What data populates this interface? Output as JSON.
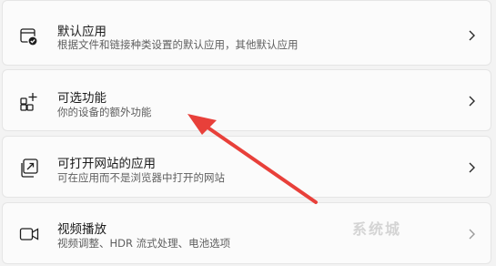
{
  "items": [
    {
      "title": "默认应用",
      "desc": "根据文件和链接种类设置的默认应用，其他默认应用",
      "icon": "default-apps-icon"
    },
    {
      "title": "可选功能",
      "desc": "你的设备的额外功能",
      "icon": "optional-features-icon"
    },
    {
      "title": "可打开网站的应用",
      "desc": "可在应用而不是浏览器中打开的网站",
      "icon": "apps-for-websites-icon"
    },
    {
      "title": "视频播放",
      "desc": "视频调整、HDR 流式处理、电池选项",
      "icon": "video-playback-icon"
    }
  ],
  "watermark": "系统城",
  "colors": {
    "background": "#f3f3f3",
    "card": "#fbfbfb",
    "arrow": "#e8403a"
  }
}
